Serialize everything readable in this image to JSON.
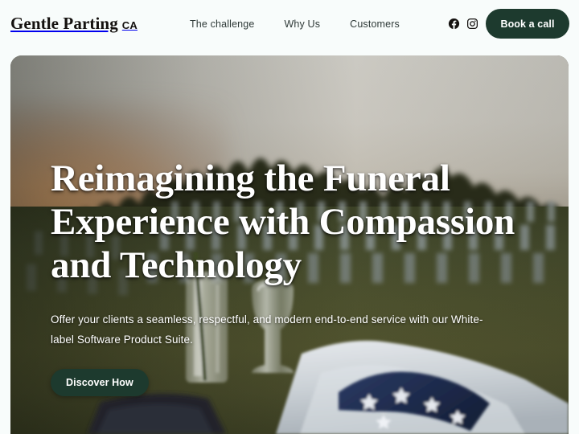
{
  "header": {
    "brand": {
      "name": "Gentle Parting",
      "suffix": "CA"
    },
    "nav": [
      {
        "label": "The challenge"
      },
      {
        "label": "Why Us"
      },
      {
        "label": "Customers"
      }
    ],
    "social": [
      {
        "name": "facebook-icon",
        "label": "Facebook"
      },
      {
        "name": "instagram-icon",
        "label": "Instagram"
      }
    ],
    "cta_label": "Book a call",
    "background_color": "#f8fcfb",
    "nav_text_color": "#2f3a38"
  },
  "hero": {
    "title": "Reimagining the Funeral Experience with Compassion and Technology",
    "subtitle": "Offer your clients a seamless, respectful, and modern end-to-end service with our White-label Software Product Suite.",
    "cta_label": "Discover How",
    "image_description": "Blurred sunset photo of a military cemetery with rows of headstones and flags, a glass vase holding a red rose, an overturned wine glass, a white cloth and a folded American flag in the foreground",
    "accent_color": "#1d3a2e",
    "text_color": "#ffffff"
  }
}
